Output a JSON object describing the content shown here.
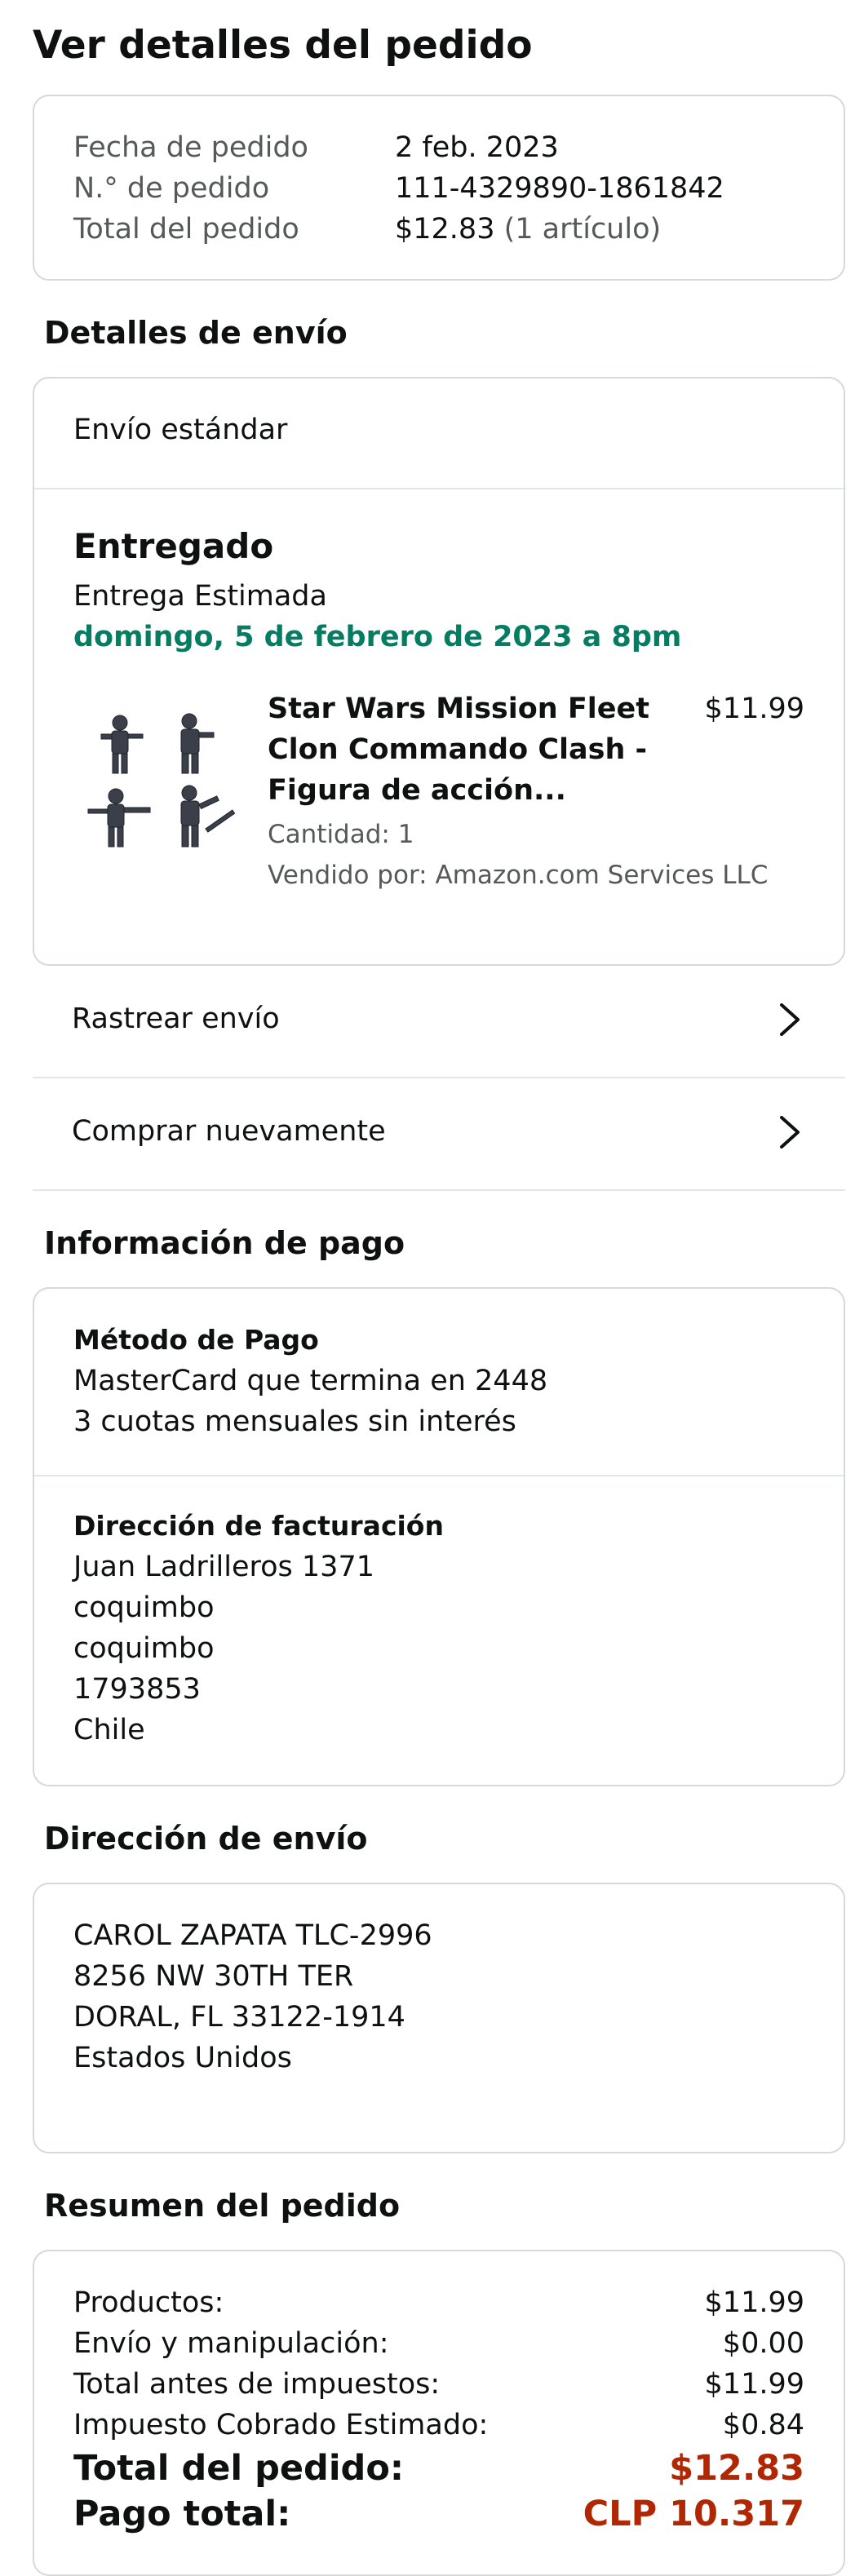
{
  "page_title": "Ver detalles del pedido",
  "summary": {
    "rows": [
      {
        "label": "Fecha de pedido",
        "value": "2 feb. 2023"
      },
      {
        "label": "N.° de pedido",
        "value": "111-4329890-1861842"
      },
      {
        "label": "Total del pedido",
        "value": "$12.83",
        "extra": "(1 artículo)"
      }
    ]
  },
  "shipping": {
    "heading": "Detalles de envío",
    "method": "Envío estándar",
    "status": "Entregado",
    "eta_label": "Entrega Estimada",
    "eta_date": "domingo, 5 de febrero de 2023 a 8pm",
    "item": {
      "title_line1": "Star Wars Mission Fleet",
      "title_line2": "Clon Commando Clash -",
      "title_line3": "Figura de acción...",
      "price": "$11.99",
      "quantity": "Cantidad: 1",
      "seller": "Vendido por: Amazon.com Services LLC"
    },
    "actions": [
      {
        "label": "Rastrear envío"
      },
      {
        "label": "Comprar nuevamente"
      }
    ]
  },
  "payment": {
    "heading": "Información de pago",
    "method_title": "Método de Pago",
    "method_line1": "MasterCard que termina en 2448",
    "method_line2": "3 cuotas mensuales sin interés",
    "billing_title": "Dirección de facturación",
    "billing_lines": [
      "Juan Ladrilleros 1371",
      "coquimbo",
      "coquimbo",
      "1793853",
      "Chile"
    ]
  },
  "ship_address": {
    "heading": "Dirección de envío",
    "lines": [
      "CAROL ZAPATA TLC-2996",
      "8256 NW 30TH TER",
      "DORAL, FL 33122-1914",
      "Estados Unidos"
    ]
  },
  "order_summary": {
    "heading": "Resumen del pedido",
    "rows": [
      {
        "label": "Productos:",
        "value": "$11.99"
      },
      {
        "label": "Envío y manipulación:",
        "value": "$0.00"
      },
      {
        "label": "Total antes de impuestos:",
        "value": "$11.99"
      },
      {
        "label": "Impuesto Cobrado Estimado:",
        "value": "$0.84"
      }
    ],
    "total_label": "Total del pedido:",
    "total_value": "$12.83",
    "paid_label": "Pago total:",
    "paid_value": "CLP 10.317"
  },
  "colors": {
    "green": "#067d62",
    "price_red": "#b12704",
    "border": "#d5d9d9"
  },
  "icons": [
    "chevron-right-icon",
    "product-thumbnail-image"
  ]
}
